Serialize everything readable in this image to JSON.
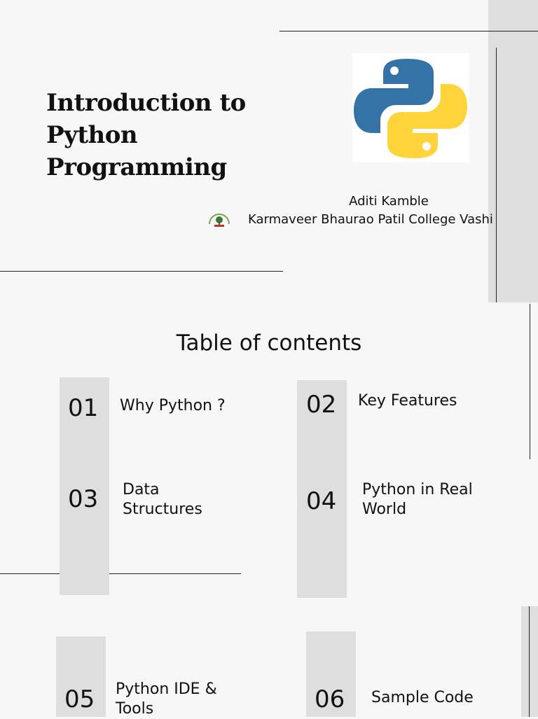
{
  "slide1": {
    "title_line1": "Introduction to Python",
    "title_line2": "Programming",
    "author": "Aditi Kamble",
    "college": "Karmaveer Bhaurao Patil College Vashi",
    "logo_icon": "python-logo-icon",
    "emblem_icon": "college-emblem-icon"
  },
  "toc": {
    "heading": "Table of contents",
    "items": [
      {
        "number": "01",
        "label": "Why Python ?"
      },
      {
        "number": "02",
        "label": "Key Features"
      },
      {
        "number": "03",
        "label_line1": "Data",
        "label_line2": "Structures"
      },
      {
        "number": "04",
        "label_line1": "Python in Real",
        "label_line2": "World"
      },
      {
        "number": "05",
        "label_line1": "Python IDE &",
        "label_line2": "Tools"
      },
      {
        "number": "06",
        "label": "Sample Code"
      }
    ]
  },
  "colors": {
    "python_blue": "#3572a5",
    "python_yellow": "#ffd43b",
    "panel_gray": "#dedede",
    "background": "#f7f7f7"
  }
}
